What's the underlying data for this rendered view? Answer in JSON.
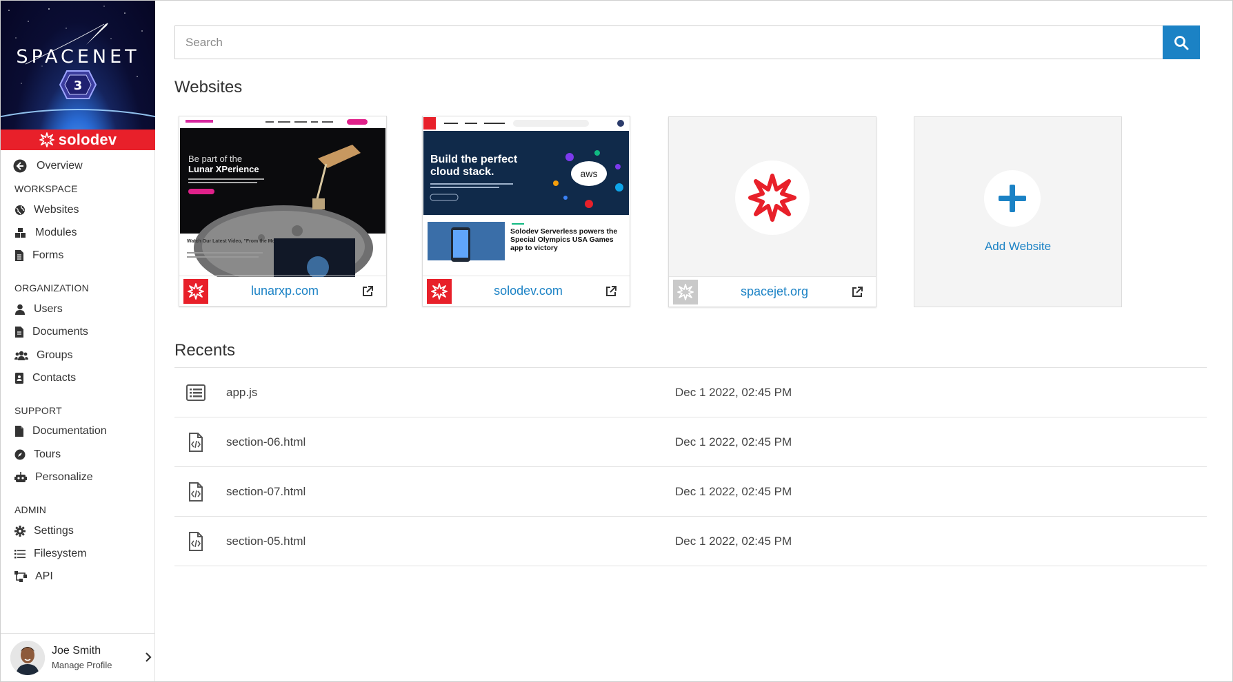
{
  "app": {
    "brand_title": "SPACENET",
    "brand_badge": "3",
    "vendor": "solodev",
    "colors": {
      "accent": "#1b82c5",
      "brand_red": "#e8202a"
    }
  },
  "sidebar": {
    "overview": {
      "label": "Overview",
      "icon": "arrow-left-circle-icon"
    },
    "sections": [
      {
        "title": "WORKSPACE",
        "items": [
          {
            "label": "Websites",
            "icon": "globe-icon"
          },
          {
            "label": "Modules",
            "icon": "cubes-icon"
          },
          {
            "label": "Forms",
            "icon": "document-list-icon"
          }
        ]
      },
      {
        "title": "ORGANIZATION",
        "items": [
          {
            "label": "Users",
            "icon": "user-icon"
          },
          {
            "label": "Documents",
            "icon": "document-icon"
          },
          {
            "label": "Groups",
            "icon": "users-icon"
          },
          {
            "label": "Contacts",
            "icon": "contact-card-icon"
          }
        ]
      },
      {
        "title": "SUPPORT",
        "items": [
          {
            "label": "Documentation",
            "icon": "file-icon"
          },
          {
            "label": "Tours",
            "icon": "compass-icon"
          },
          {
            "label": "Personalize",
            "icon": "robot-icon"
          }
        ]
      },
      {
        "title": "ADMIN",
        "items": [
          {
            "label": "Settings",
            "icon": "gear-icon"
          },
          {
            "label": "Filesystem",
            "icon": "list-icon"
          },
          {
            "label": "API",
            "icon": "sitemap-icon"
          }
        ]
      }
    ],
    "profile": {
      "name": "Joe Smith",
      "subtitle": "Manage Profile"
    }
  },
  "search": {
    "placeholder": "Search"
  },
  "websites": {
    "title": "Websites",
    "cards": [
      {
        "domain": "lunarxp.com",
        "preview_headline": "Be part of the",
        "preview_headline2": "Lunar XPerience",
        "preview_sub": "Watch Our Latest Video, \"From the Moon to Mars\""
      },
      {
        "domain": "solodev.com",
        "preview_headline": "Build the perfect",
        "preview_headline2": "cloud stack.",
        "preview_sub": "Solodev Serverless powers the Special Olympics USA Games app to victory",
        "preview_tag": "aws"
      },
      {
        "domain": "spacejet.org"
      }
    ],
    "add_label": "Add Website"
  },
  "recents": {
    "title": "Recents",
    "items": [
      {
        "name": "app.js",
        "date": "Dec 1 2022, 02:45 PM",
        "icon": "list-file-icon"
      },
      {
        "name": "section-06.html",
        "date": "Dec 1 2022, 02:45 PM",
        "icon": "code-file-icon"
      },
      {
        "name": "section-07.html",
        "date": "Dec 1 2022, 02:45 PM",
        "icon": "code-file-icon"
      },
      {
        "name": "section-05.html",
        "date": "Dec 1 2022, 02:45 PM",
        "icon": "code-file-icon"
      }
    ]
  }
}
